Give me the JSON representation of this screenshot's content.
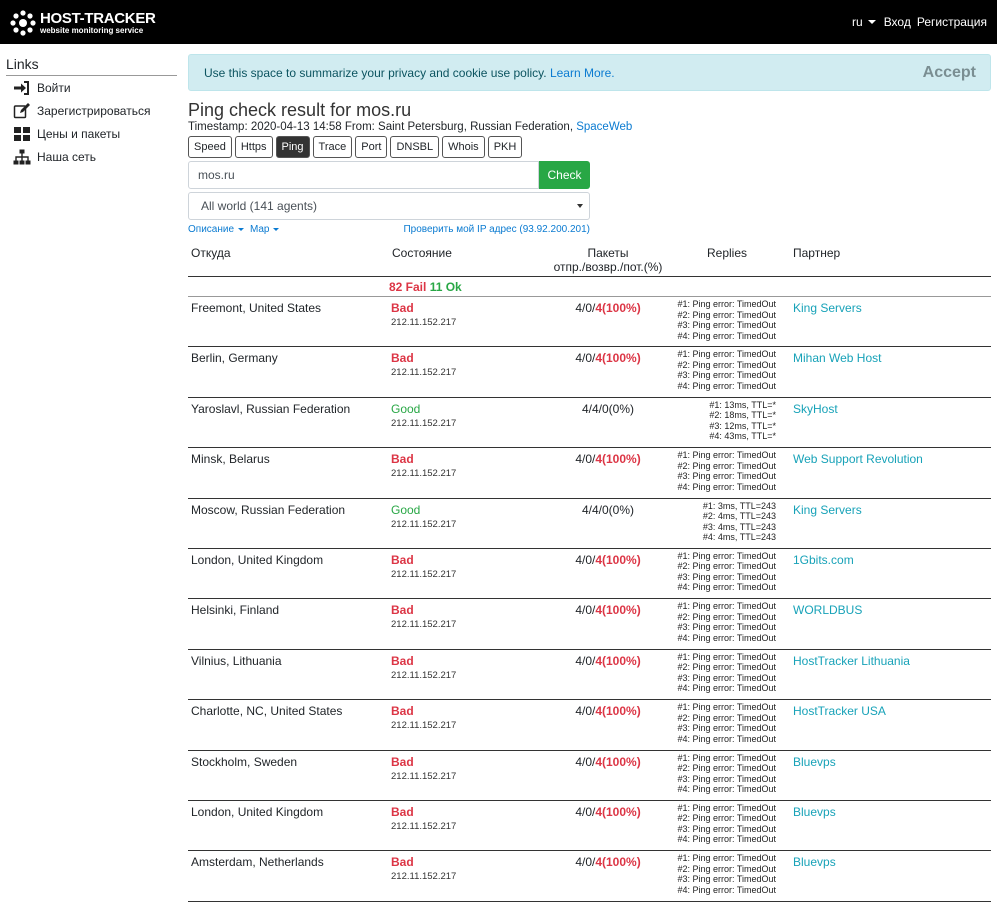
{
  "header": {
    "logo_title": "HOST-TRACKER",
    "logo_subtitle": "website monitoring service",
    "lang": "ru",
    "login": "Вход",
    "register": "Регистрация"
  },
  "sidebar": {
    "title": "Links",
    "items": [
      {
        "label": "Войти",
        "icon": "sign-in-icon"
      },
      {
        "label": "Зарегистрироваться",
        "icon": "edit-icon"
      },
      {
        "label": "Цены и пакеты",
        "icon": "grid-icon"
      },
      {
        "label": "Наша сеть",
        "icon": "network-icon"
      }
    ]
  },
  "cookie": {
    "text": "Use this space to summarize your privacy and cookie use policy.",
    "link": "Learn More.",
    "accept": "Accept"
  },
  "main": {
    "title": "Ping check result for mos.ru",
    "timestamp_label": "Timestamp: 2020-04-13 14:58  From: Saint Petersburg, Russian Federation,",
    "timestamp_link": "SpaceWeb",
    "tabs": [
      "Speed",
      "Https",
      "Ping",
      "Trace",
      "Port",
      "DNSBL",
      "Whois",
      "PKH"
    ],
    "active_tab": "Ping",
    "input_value": "mos.ru",
    "check_label": "Check",
    "agents_selected": "All world (141 agents)",
    "description_link": "Описание",
    "map_link": "Map",
    "my_ip_link": "Проверить мой IP адрес (93.92.200.201)"
  },
  "table": {
    "headers": {
      "from": "Откуда",
      "state": "Состояние",
      "packets": "Пакеты",
      "packets_sub": "отпр./возвр./пот.(%)",
      "replies": "Replies",
      "partner": "Партнер"
    },
    "summary_fail": "82 Fail",
    "summary_ok": "11 Ok",
    "rows": [
      {
        "from": "Freemont, United States",
        "state": "Bad",
        "ip": "212.11.152.217",
        "packets_prefix": "4/0/",
        "packets_loss": "4(100%)",
        "replies": [
          "#1: Ping error: TimedOut",
          "#2: Ping error: TimedOut",
          "#3: Ping error: TimedOut",
          "#4: Ping error: TimedOut"
        ],
        "partner": "King Servers"
      },
      {
        "from": "Berlin, Germany",
        "state": "Bad",
        "ip": "212.11.152.217",
        "packets_prefix": "4/0/",
        "packets_loss": "4(100%)",
        "replies": [
          "#1: Ping error: TimedOut",
          "#2: Ping error: TimedOut",
          "#3: Ping error: TimedOut",
          "#4: Ping error: TimedOut"
        ],
        "partner": "Mihan Web Host"
      },
      {
        "from": "Yaroslavl, Russian Federation",
        "state": "Good",
        "ip": "212.11.152.217",
        "packets_prefix": "4/4/0(0%)",
        "packets_loss": "",
        "replies": [
          "#1: 13ms, TTL=*",
          "#2: 18ms, TTL=*",
          "#3: 12ms, TTL=*",
          "#4: 43ms, TTL=*"
        ],
        "partner": "SkyHost"
      },
      {
        "from": "Minsk, Belarus",
        "state": "Bad",
        "ip": "212.11.152.217",
        "packets_prefix": "4/0/",
        "packets_loss": "4(100%)",
        "replies": [
          "#1: Ping error: TimedOut",
          "#2: Ping error: TimedOut",
          "#3: Ping error: TimedOut",
          "#4: Ping error: TimedOut"
        ],
        "partner": "Web Support Revolution"
      },
      {
        "from": "Moscow, Russian Federation",
        "state": "Good",
        "ip": "212.11.152.217",
        "packets_prefix": "4/4/0(0%)",
        "packets_loss": "",
        "replies": [
          "#1: 3ms, TTL=243",
          "#2: 4ms, TTL=243",
          "#3: 4ms, TTL=243",
          "#4: 4ms, TTL=243"
        ],
        "partner": "King Servers"
      },
      {
        "from": "London, United Kingdom",
        "state": "Bad",
        "ip": "212.11.152.217",
        "packets_prefix": "4/0/",
        "packets_loss": "4(100%)",
        "replies": [
          "#1: Ping error: TimedOut",
          "#2: Ping error: TimedOut",
          "#3: Ping error: TimedOut",
          "#4: Ping error: TimedOut"
        ],
        "partner": "1Gbits.com"
      },
      {
        "from": "Helsinki, Finland",
        "state": "Bad",
        "ip": "212.11.152.217",
        "packets_prefix": "4/0/",
        "packets_loss": "4(100%)",
        "replies": [
          "#1: Ping error: TimedOut",
          "#2: Ping error: TimedOut",
          "#3: Ping error: TimedOut",
          "#4: Ping error: TimedOut"
        ],
        "partner": "WORLDBUS"
      },
      {
        "from": "Vilnius, Lithuania",
        "state": "Bad",
        "ip": "212.11.152.217",
        "packets_prefix": "4/0/",
        "packets_loss": "4(100%)",
        "replies": [
          "#1: Ping error: TimedOut",
          "#2: Ping error: TimedOut",
          "#3: Ping error: TimedOut",
          "#4: Ping error: TimedOut"
        ],
        "partner": "HostTracker Lithuania"
      },
      {
        "from": "Charlotte, NC, United States",
        "state": "Bad",
        "ip": "212.11.152.217",
        "packets_prefix": "4/0/",
        "packets_loss": "4(100%)",
        "replies": [
          "#1: Ping error: TimedOut",
          "#2: Ping error: TimedOut",
          "#3: Ping error: TimedOut",
          "#4: Ping error: TimedOut"
        ],
        "partner": "HostTracker USA"
      },
      {
        "from": "Stockholm, Sweden",
        "state": "Bad",
        "ip": "212.11.152.217",
        "packets_prefix": "4/0/",
        "packets_loss": "4(100%)",
        "replies": [
          "#1: Ping error: TimedOut",
          "#2: Ping error: TimedOut",
          "#3: Ping error: TimedOut",
          "#4: Ping error: TimedOut"
        ],
        "partner": "Bluevps"
      },
      {
        "from": "London, United Kingdom",
        "state": "Bad",
        "ip": "212.11.152.217",
        "packets_prefix": "4/0/",
        "packets_loss": "4(100%)",
        "replies": [
          "#1: Ping error: TimedOut",
          "#2: Ping error: TimedOut",
          "#3: Ping error: TimedOut",
          "#4: Ping error: TimedOut"
        ],
        "partner": "Bluevps"
      },
      {
        "from": "Amsterdam, Netherlands",
        "state": "Bad",
        "ip": "212.11.152.217",
        "packets_prefix": "4/0/",
        "packets_loss": "4(100%)",
        "replies": [
          "#1: Ping error: TimedOut",
          "#2: Ping error: TimedOut",
          "#3: Ping error: TimedOut",
          "#4: Ping error: TimedOut"
        ],
        "partner": "Bluevps"
      }
    ]
  },
  "colors": {
    "bad": "#dc3545",
    "good": "#28a745",
    "partner": "#17a2b8",
    "check_button": "#28a745"
  }
}
